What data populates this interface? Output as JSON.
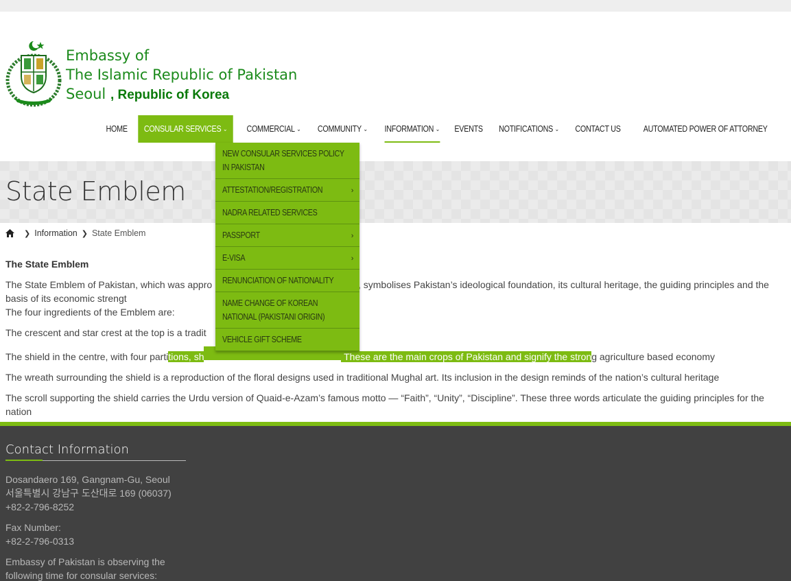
{
  "header": {
    "logo_line1": "Embassy of",
    "logo_line2": "The Islamic Republic of Pakistan",
    "logo_line3a": "Seoul",
    "logo_line3b": ", Republic of Korea"
  },
  "nav": {
    "items": [
      {
        "label": "HOME"
      },
      {
        "label": "CONSULAR SERVICES"
      },
      {
        "label": "COMMERCIAL"
      },
      {
        "label": "COMMUNITY"
      },
      {
        "label": "INFORMATION"
      },
      {
        "label": "EVENTS"
      },
      {
        "label": "NOTIFICATIONS"
      },
      {
        "label": "CONTACT US"
      },
      {
        "label": "AUTOMATED POWER OF ATTORNEY"
      }
    ]
  },
  "dropdown": {
    "items": [
      {
        "label": "NEW CONSULAR SERVICES POLICY IN PAKISTAN"
      },
      {
        "label": "ATTESTATION/REGISTRATION"
      },
      {
        "label": "NADRA RELATED SERVICES"
      },
      {
        "label": "PASSPORT"
      },
      {
        "label": "E-VISA"
      },
      {
        "label": "RENUNCIATION OF NATIONALITY"
      },
      {
        "label": "NAME CHANGE OF KOREAN NATIONAL (PAKISTANI ORIGIN)"
      },
      {
        "label": "VEHICLE GIFT SCHEME"
      }
    ]
  },
  "banner": {
    "title": "State Emblem"
  },
  "breadcrumb": {
    "level1": "Information",
    "current": "State Emblem"
  },
  "content": {
    "heading": "The State Emblem",
    "p1a": "The State Emblem of Pakistan, which was appro",
    "p1b": " in 1954, symbolises Pakistan’s ideological foundation, its cultural heritage, the guiding principles and the basis of its economic strengt",
    "p1c": "The four ingredients of the Emblem are:",
    "p2": "The crescent and star crest at the top is a tradit",
    "p3a": "The shield in the centre, with four parti",
    "p3hl1": "tions, sh",
    "p3hl2": " These are the main crops of Pakistan and signify the stron",
    "p3b": "g agriculture based economy",
    "p4": "The wreath surrounding the shield is a reproduction of the floral designs used in traditional Mughal art. Its inclusion in the design reminds of the nation’s cultural heritage",
    "p5": "The scroll supporting the shield carries the Urdu version of Quaid-e-Azam’s famous motto — “Faith”, “Unity”, “Discipline”. These three words articulate the guiding principles for the nation"
  },
  "footer": {
    "title": "Contact Information",
    "addr1": "Dosandaero 169, Gangnam-Gu, Seoul",
    "addr2": "서울특별시 강남구 도산대로 169 (06037)",
    "phone": "+82-2-796-8252",
    "fax_label": "Fax Number:",
    "fax": "+82-2-796-0313",
    "note": "Embassy of Pakistan is observing the following time for consular services:"
  },
  "colors": {
    "accent": "#7dbb12",
    "logo_green": "#1b8a1b",
    "footer_bg": "#414141"
  },
  "icons": {
    "home": "home-icon",
    "chevron": "chevron-down-icon",
    "arrow": "chevron-right-icon"
  }
}
